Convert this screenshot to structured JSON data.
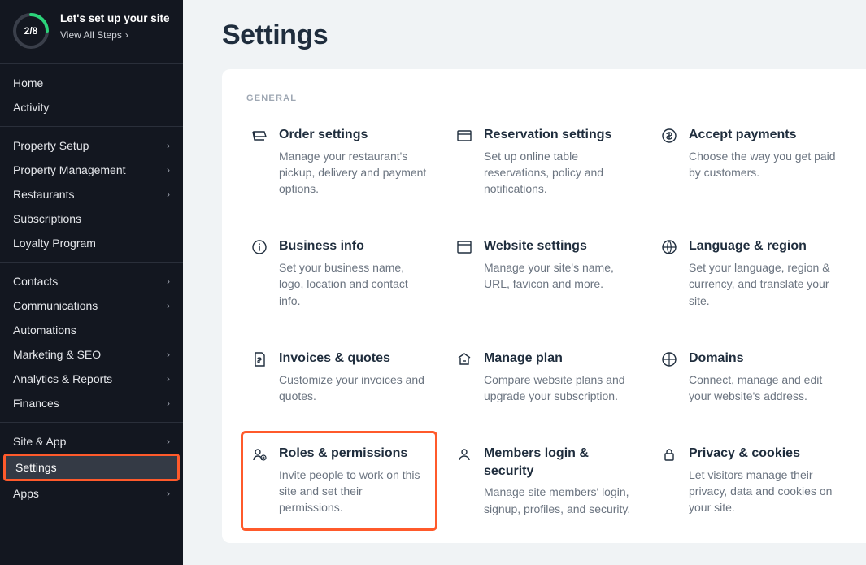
{
  "setup": {
    "progress": "2/8",
    "title": "Let's set up your site",
    "link": "View All Steps"
  },
  "sidebar": {
    "group1": [
      "Home",
      "Activity"
    ],
    "group2": [
      {
        "label": "Property Setup",
        "hasSub": true
      },
      {
        "label": "Property Management",
        "hasSub": true
      },
      {
        "label": "Restaurants",
        "hasSub": true
      },
      {
        "label": "Subscriptions",
        "hasSub": false
      },
      {
        "label": "Loyalty Program",
        "hasSub": false
      }
    ],
    "group3": [
      {
        "label": "Contacts",
        "hasSub": true
      },
      {
        "label": "Communications",
        "hasSub": true
      },
      {
        "label": "Automations",
        "hasSub": false
      },
      {
        "label": "Marketing & SEO",
        "hasSub": true
      },
      {
        "label": "Analytics & Reports",
        "hasSub": true
      },
      {
        "label": "Finances",
        "hasSub": true
      }
    ],
    "group4": [
      {
        "label": "Site & App",
        "hasSub": true
      },
      {
        "label": "Settings",
        "hasSub": false,
        "active": true
      },
      {
        "label": "Apps",
        "hasSub": true
      }
    ]
  },
  "page": {
    "title": "Settings"
  },
  "sectionLabel": "GENERAL",
  "tiles": [
    {
      "icon": "order",
      "title": "Order settings",
      "desc": "Manage your restaurant's pickup, delivery and payment options."
    },
    {
      "icon": "reservation",
      "title": "Reservation settings",
      "desc": "Set up online table reservations, policy and notifications."
    },
    {
      "icon": "payments",
      "title": "Accept payments",
      "desc": "Choose the way you get paid by customers."
    },
    {
      "icon": "info",
      "title": "Business info",
      "desc": "Set your business name, logo, location and contact info."
    },
    {
      "icon": "website",
      "title": "Website settings",
      "desc": "Manage your site's name, URL, favicon and more."
    },
    {
      "icon": "language",
      "title": "Language & region",
      "desc": "Set your language, region & currency, and translate your site."
    },
    {
      "icon": "invoices",
      "title": "Invoices & quotes",
      "desc": "Customize your invoices and quotes."
    },
    {
      "icon": "plan",
      "title": "Manage plan",
      "desc": "Compare website plans and upgrade your subscription."
    },
    {
      "icon": "domains",
      "title": "Domains",
      "desc": "Connect, manage and edit your website's address."
    },
    {
      "icon": "roles",
      "title": "Roles & permissions",
      "desc": "Invite people to work on this site and set their permissions.",
      "highlighted": true
    },
    {
      "icon": "members",
      "title": "Members login & security",
      "desc": "Manage site members' login, signup, profiles, and security."
    },
    {
      "icon": "privacy",
      "title": "Privacy & cookies",
      "desc": "Let visitors manage their privacy, data and cookies on your site."
    }
  ]
}
